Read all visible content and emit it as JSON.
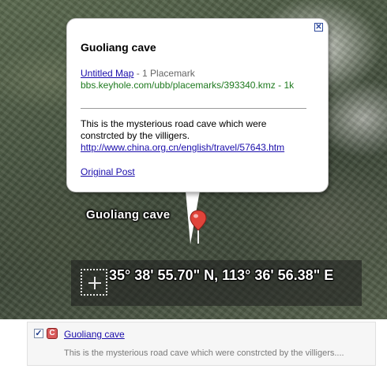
{
  "balloon": {
    "close_symbol": "✕",
    "title": "Guoliang cave",
    "map_link": "Untitled Map",
    "placemark_count": " - 1 Placemark",
    "source_url": "bbs.keyhole.com/ubb/placemarks/393340.kmz - 1k",
    "description": "This is the mysterious road cave which were constrcted by the villigers.",
    "desc_link": "http://www.china.org.cn/english/travel/57643.htm",
    "post_link": "Original Post"
  },
  "placemark": {
    "label": "Guoliang cave",
    "pin_color": "#e0443a"
  },
  "coordinates": {
    "text": "35° 38' 55.70\" N, 113° 36' 56.38\" E"
  },
  "places_item": {
    "checkbox_mark": "✓",
    "icon_letter": "C",
    "name": "Guoliang cave",
    "description": "This is the mysterious road cave which were constrcted by the villigers...."
  }
}
